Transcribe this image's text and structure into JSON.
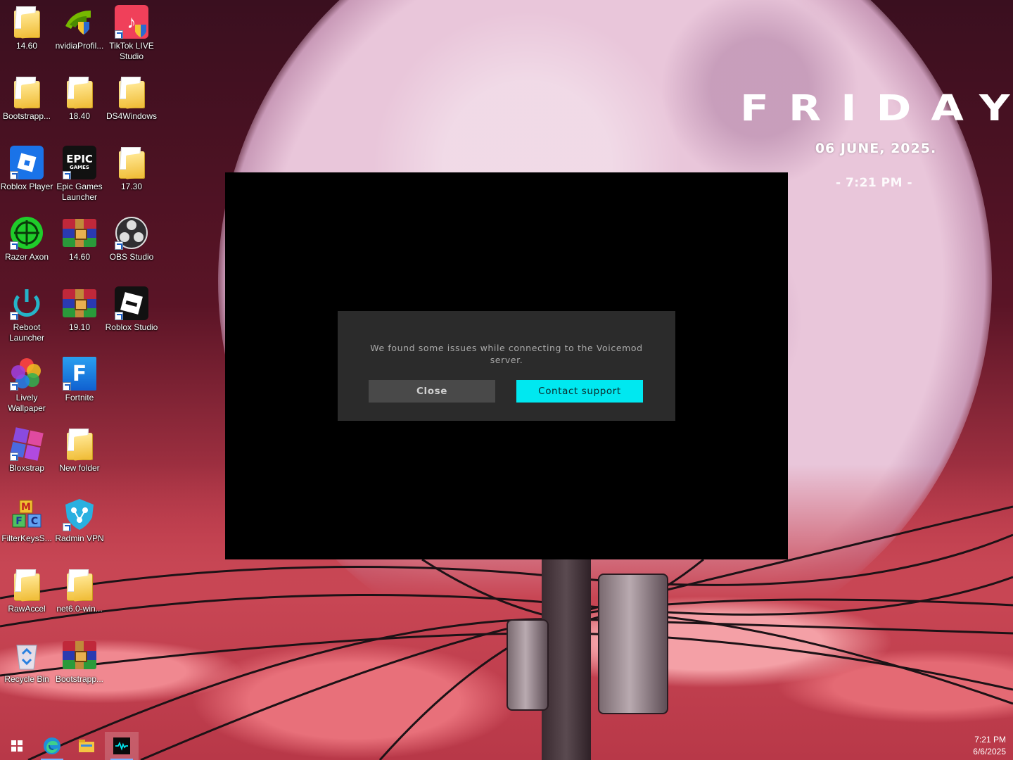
{
  "desktop": {
    "icons": [
      {
        "label": "14.60",
        "icon": "folder-icon"
      },
      {
        "label": "nvidiaProfil...",
        "icon": "nvidia-profile-inspector-icon"
      },
      {
        "label": "TikTok LIVE Studio",
        "icon": "tiktok-live-studio-icon"
      },
      {
        "label": "Bootstrapp...",
        "icon": "folder-icon"
      },
      {
        "label": "18.40",
        "icon": "folder-icon"
      },
      {
        "label": "DS4Windows",
        "icon": "folder-icon"
      },
      {
        "label": "Roblox Player",
        "icon": "roblox-player-icon"
      },
      {
        "label": "Epic Games Launcher",
        "icon": "epic-games-icon"
      },
      {
        "label": "17.30",
        "icon": "folder-icon"
      },
      {
        "label": "Razer Axon",
        "icon": "razer-axon-icon"
      },
      {
        "label": "14.60",
        "icon": "winrar-archive-icon"
      },
      {
        "label": "OBS Studio",
        "icon": "obs-studio-icon"
      },
      {
        "label": "Reboot Launcher",
        "icon": "reboot-launcher-icon"
      },
      {
        "label": "19.10",
        "icon": "winrar-archive-icon"
      },
      {
        "label": "Roblox Studio",
        "icon": "roblox-studio-icon"
      },
      {
        "label": "Lively Wallpaper",
        "icon": "lively-wallpaper-icon"
      },
      {
        "label": "Fortnite",
        "icon": "fortnite-icon"
      },
      {
        "label": "Bloxstrap",
        "icon": "bloxstrap-icon"
      },
      {
        "label": "New folder",
        "icon": "folder-icon"
      },
      {
        "label": "FilterKeysS...",
        "icon": "filterkeys-icon"
      },
      {
        "label": "Radmin VPN",
        "icon": "radmin-vpn-icon"
      },
      {
        "label": "RawAccel",
        "icon": "folder-icon"
      },
      {
        "label": "net6.0-win...",
        "icon": "folder-icon"
      },
      {
        "label": "Recycle Bin",
        "icon": "recycle-bin-icon"
      },
      {
        "label": "Bootstrapp...",
        "icon": "winrar-archive-icon"
      }
    ]
  },
  "widget": {
    "day": "FRIDAY",
    "date": "06 JUNE, 2025.",
    "time": "- 7:21 PM -"
  },
  "dialog": {
    "message": "We found some issues while connecting to the Voicemod server.",
    "close_label": "Close",
    "support_label": "Contact support",
    "accent_color": "#00e8f0"
  },
  "taskbar": {
    "items": [
      "start-icon",
      "edge-icon",
      "file-explorer-icon",
      "voicemod-icon"
    ],
    "clock_time": "7:21 PM",
    "clock_date": "6/6/2025"
  }
}
